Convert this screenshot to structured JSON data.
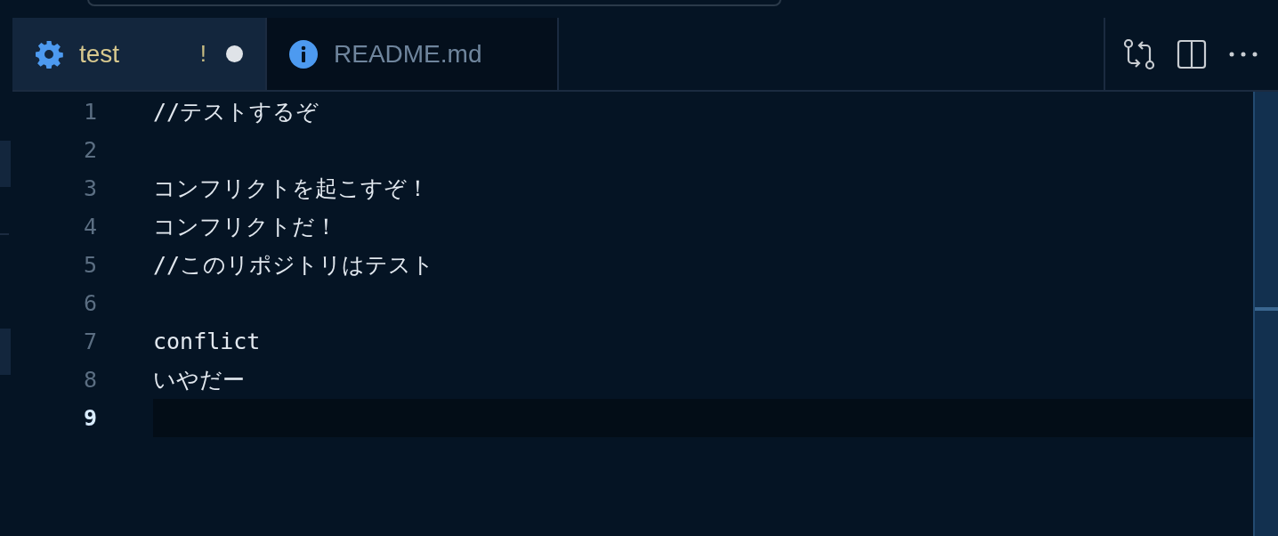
{
  "tabs": [
    {
      "label": "test",
      "kind": "settings",
      "selected": true,
      "problem": "!",
      "dirty": true
    },
    {
      "label": "README.md",
      "kind": "markdown",
      "selected": false,
      "dirty": false
    }
  ],
  "editor": {
    "lines": [
      {
        "number": "1",
        "text": "//テストするぞ",
        "current": false
      },
      {
        "number": "2",
        "current": false
      },
      {
        "number": "3",
        "text": "コンフリクトを起こすぞ！",
        "current": false
      },
      {
        "number": "4",
        "text": "コンフリクトだ！",
        "current": false
      },
      {
        "number": "5",
        "text": "//このリポジトリはテスト",
        "current": false
      },
      {
        "number": "6",
        "current": false
      },
      {
        "number": "7",
        "text": "conflict",
        "current": false
      },
      {
        "number": "8",
        "text": "いやだー",
        "current": false
      },
      {
        "number": "9",
        "current": true
      }
    ]
  }
}
